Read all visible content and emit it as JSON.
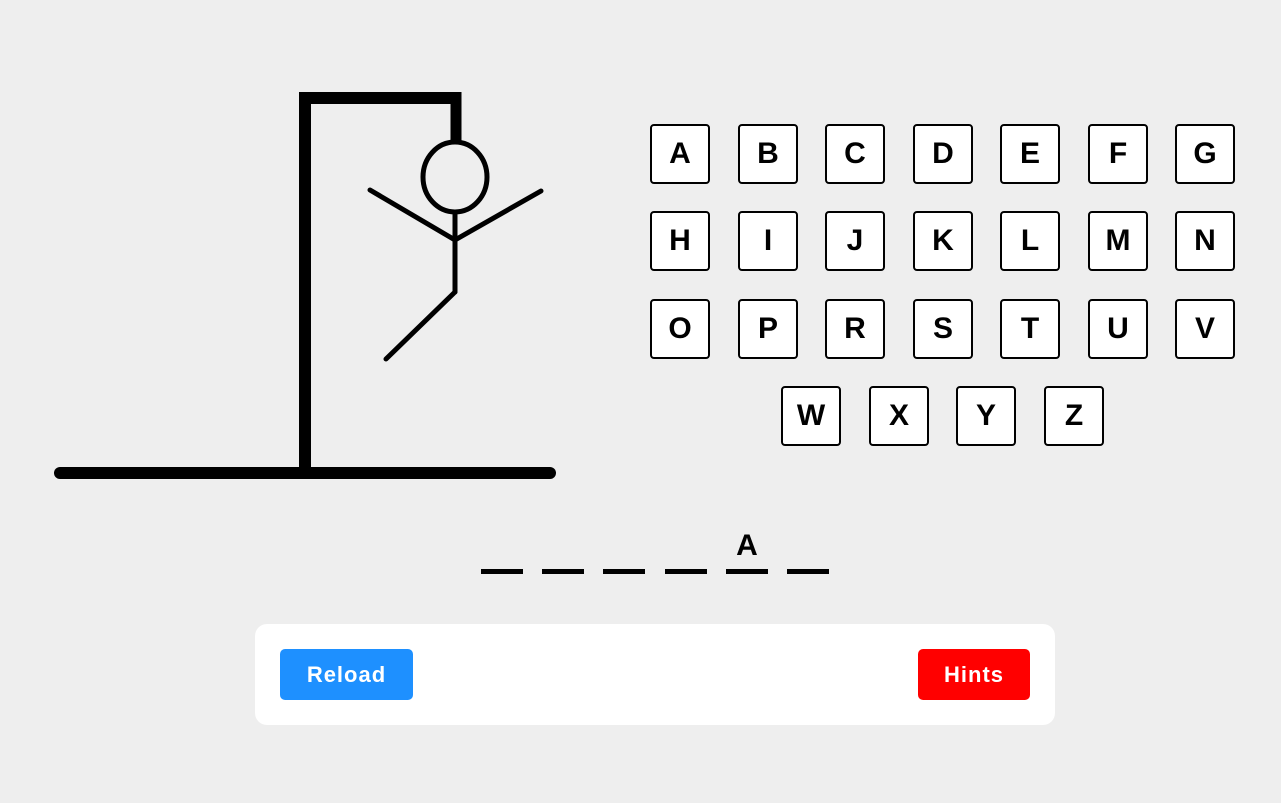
{
  "keyboard": {
    "rows": [
      [
        "A",
        "B",
        "C",
        "D",
        "E",
        "F",
        "G"
      ],
      [
        "H",
        "I",
        "J",
        "K",
        "L",
        "M",
        "N"
      ],
      [
        "O",
        "P",
        "R",
        "S",
        "T",
        "U",
        "V"
      ],
      [
        "W",
        "X",
        "Y",
        "Z"
      ]
    ]
  },
  "word": {
    "slots": [
      "",
      "",
      "",
      "",
      "A",
      ""
    ]
  },
  "controls": {
    "reload_label": "Reload",
    "hints_label": "Hints"
  },
  "colors": {
    "background": "#eeeeee",
    "reload": "#1e90ff",
    "hints": "#ff0000"
  },
  "hangman": {
    "parts_shown": [
      "head",
      "body",
      "left-arm",
      "right-arm",
      "left-leg"
    ],
    "wrong_guesses": 5
  }
}
